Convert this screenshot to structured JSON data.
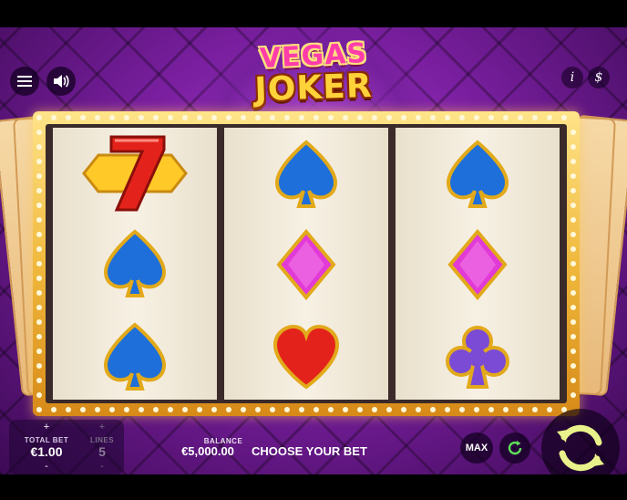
{
  "game": {
    "logo_line1": "VEGAS",
    "logo_line2": "JOKER"
  },
  "top_controls": {
    "menu_icon": "hamburger-icon",
    "sound_icon": "speaker-icon",
    "info_label": "i",
    "paytable_label": "$"
  },
  "reels": [
    {
      "symbols": [
        "seven",
        "spade",
        "spade"
      ]
    },
    {
      "symbols": [
        "spade",
        "diamond",
        "heart"
      ]
    },
    {
      "symbols": [
        "spade",
        "diamond",
        "club"
      ]
    }
  ],
  "colors": {
    "background": "#7a1fa0",
    "frame_gold": "#f0b93d",
    "spade_blue": "#1e6fd9",
    "diamond_pink": "#e23ad6",
    "heart_red": "#e3231b",
    "club_purple": "#7b4bd6"
  },
  "bottom_bar": {
    "total_bet_label": "TOTAL BET",
    "total_bet_value": "€1.00",
    "lines_label": "LINES",
    "lines_value": "5",
    "plus": "+",
    "minus": "-",
    "balance_label": "BALANCE",
    "balance_value": "€5,000.00",
    "message": "CHOOSE YOUR BET",
    "max_label": "MAX"
  }
}
